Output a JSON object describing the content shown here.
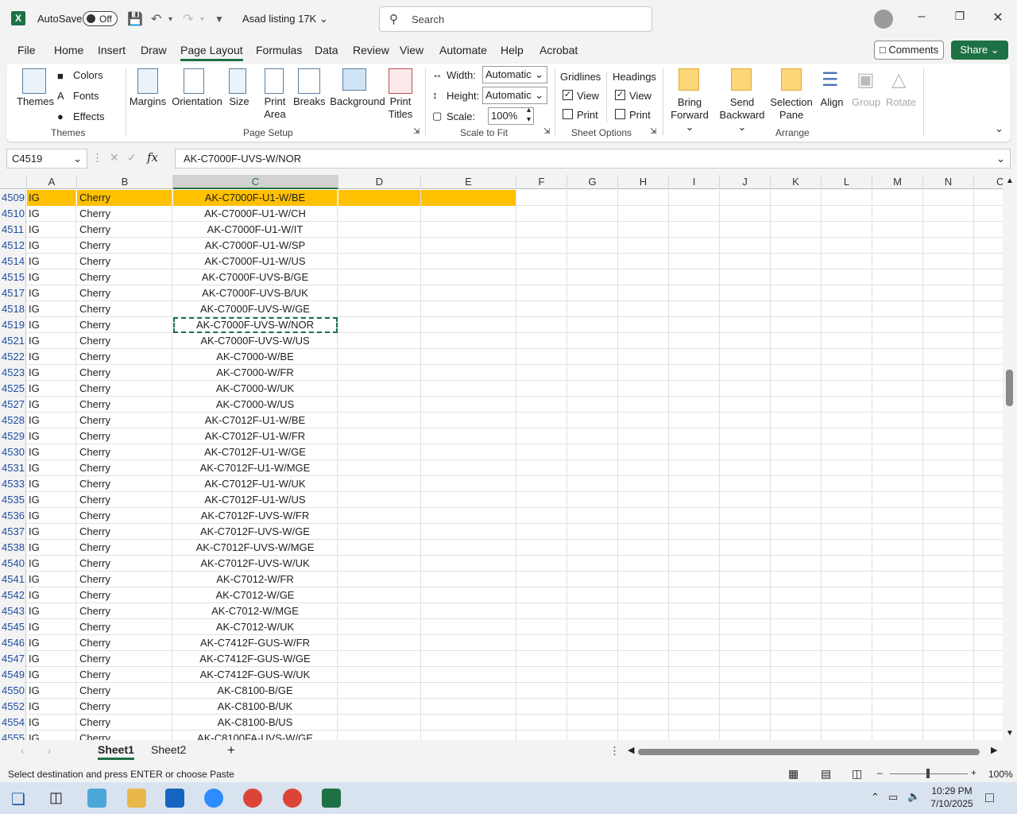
{
  "titlebar": {
    "autosave_label": "AutoSave",
    "autosave_state": "Off",
    "doc_title": "Asad listing 17K",
    "search_placeholder": "Search"
  },
  "menu": {
    "tabs": [
      "File",
      "Home",
      "Insert",
      "Draw",
      "Page Layout",
      "Formulas",
      "Data",
      "Review",
      "View",
      "Automate",
      "Help",
      "Acrobat"
    ],
    "active": "Page Layout",
    "comments": "Comments",
    "share": "Share"
  },
  "ribbon": {
    "themes": {
      "themes": "Themes",
      "colors": "Colors",
      "fonts": "Fonts",
      "effects": "Effects",
      "group": "Themes"
    },
    "page_setup": {
      "margins": "Margins",
      "orientation": "Orientation",
      "size": "Size",
      "print_area_1": "Print",
      "print_area_2": "Area",
      "breaks": "Breaks",
      "background": "Background",
      "print_titles_1": "Print",
      "print_titles_2": "Titles",
      "group": "Page Setup"
    },
    "scale_to_fit": {
      "width_label": "Width:",
      "width_value": "Automatic",
      "height_label": "Height:",
      "height_value": "Automatic",
      "scale_label": "Scale:",
      "scale_value": "100%",
      "group": "Scale to Fit"
    },
    "sheet_options": {
      "gridlines": "Gridlines",
      "headings": "Headings",
      "view": "View",
      "print": "Print",
      "group": "Sheet Options"
    },
    "arrange": {
      "bring_1": "Bring",
      "bring_2": "Forward",
      "send_1": "Send",
      "send_2": "Backward",
      "selection_1": "Selection",
      "selection_2": "Pane",
      "align": "Align",
      "group_btn": "Group",
      "rotate": "Rotate",
      "group": "Arrange"
    }
  },
  "formula_bar": {
    "name_box": "C4519",
    "fx": "fx",
    "content": "AK-C7000F-UVS-W/NOR"
  },
  "columns": [
    "A",
    "B",
    "C",
    "D",
    "E",
    "F",
    "G",
    "H",
    "I",
    "J",
    "K",
    "L",
    "M",
    "N",
    "C"
  ],
  "rows": [
    {
      "n": "4509",
      "a": "IG",
      "b": "Cherry",
      "c": "AK-C7000F-U1-W/BE"
    },
    {
      "n": "4510",
      "a": "IG",
      "b": "Cherry",
      "c": "AK-C7000F-U1-W/CH"
    },
    {
      "n": "4511",
      "a": "IG",
      "b": "Cherry",
      "c": "AK-C7000F-U1-W/IT"
    },
    {
      "n": "4512",
      "a": "IG",
      "b": "Cherry",
      "c": "AK-C7000F-U1-W/SP"
    },
    {
      "n": "4514",
      "a": "IG",
      "b": "Cherry",
      "c": "AK-C7000F-U1-W/US"
    },
    {
      "n": "4515",
      "a": "IG",
      "b": "Cherry",
      "c": "AK-C7000F-UVS-B/GE"
    },
    {
      "n": "4517",
      "a": "IG",
      "b": "Cherry",
      "c": "AK-C7000F-UVS-B/UK"
    },
    {
      "n": "4518",
      "a": "IG",
      "b": "Cherry",
      "c": "AK-C7000F-UVS-W/GE"
    },
    {
      "n": "4519",
      "a": "IG",
      "b": "Cherry",
      "c": "AK-C7000F-UVS-W/NOR"
    },
    {
      "n": "4521",
      "a": "IG",
      "b": "Cherry",
      "c": "AK-C7000F-UVS-W/US"
    },
    {
      "n": "4522",
      "a": "IG",
      "b": "Cherry",
      "c": "AK-C7000-W/BE"
    },
    {
      "n": "4523",
      "a": "IG",
      "b": "Cherry",
      "c": "AK-C7000-W/FR"
    },
    {
      "n": "4525",
      "a": "IG",
      "b": "Cherry",
      "c": "AK-C7000-W/UK"
    },
    {
      "n": "4527",
      "a": "IG",
      "b": "Cherry",
      "c": "AK-C7000-W/US"
    },
    {
      "n": "4528",
      "a": "IG",
      "b": "Cherry",
      "c": "AK-C7012F-U1-W/BE"
    },
    {
      "n": "4529",
      "a": "IG",
      "b": "Cherry",
      "c": "AK-C7012F-U1-W/FR"
    },
    {
      "n": "4530",
      "a": "IG",
      "b": "Cherry",
      "c": "AK-C7012F-U1-W/GE"
    },
    {
      "n": "4531",
      "a": "IG",
      "b": "Cherry",
      "c": "AK-C7012F-U1-W/MGE"
    },
    {
      "n": "4533",
      "a": "IG",
      "b": "Cherry",
      "c": "AK-C7012F-U1-W/UK"
    },
    {
      "n": "4535",
      "a": "IG",
      "b": "Cherry",
      "c": "AK-C7012F-U1-W/US"
    },
    {
      "n": "4536",
      "a": "IG",
      "b": "Cherry",
      "c": "AK-C7012F-UVS-W/FR"
    },
    {
      "n": "4537",
      "a": "IG",
      "b": "Cherry",
      "c": "AK-C7012F-UVS-W/GE"
    },
    {
      "n": "4538",
      "a": "IG",
      "b": "Cherry",
      "c": "AK-C7012F-UVS-W/MGE"
    },
    {
      "n": "4540",
      "a": "IG",
      "b": "Cherry",
      "c": "AK-C7012F-UVS-W/UK"
    },
    {
      "n": "4541",
      "a": "IG",
      "b": "Cherry",
      "c": "AK-C7012-W/FR"
    },
    {
      "n": "4542",
      "a": "IG",
      "b": "Cherry",
      "c": "AK-C7012-W/GE"
    },
    {
      "n": "4543",
      "a": "IG",
      "b": "Cherry",
      "c": "AK-C7012-W/MGE"
    },
    {
      "n": "4545",
      "a": "IG",
      "b": "Cherry",
      "c": "AK-C7012-W/UK"
    },
    {
      "n": "4546",
      "a": "IG",
      "b": "Cherry",
      "c": "AK-C7412F-GUS-W/FR"
    },
    {
      "n": "4547",
      "a": "IG",
      "b": "Cherry",
      "c": "AK-C7412F-GUS-W/GE"
    },
    {
      "n": "4549",
      "a": "IG",
      "b": "Cherry",
      "c": "AK-C7412F-GUS-W/UK"
    },
    {
      "n": "4550",
      "a": "IG",
      "b": "Cherry",
      "c": "AK-C8100-B/GE"
    },
    {
      "n": "4552",
      "a": "IG",
      "b": "Cherry",
      "c": "AK-C8100-B/UK"
    },
    {
      "n": "4554",
      "a": "IG",
      "b": "Cherry",
      "c": "AK-C8100-B/US"
    },
    {
      "n": "4555",
      "a": "IG",
      "b": "Cherry",
      "c": "AK-C8100FA-UVS-W/GE"
    }
  ],
  "highlight_row": "4509",
  "selected_row": "4519",
  "highlight_color": "#ffc000",
  "sheets": [
    "Sheet1",
    "Sheet2"
  ],
  "active_sheet": "Sheet1",
  "status": {
    "message": "Select destination and press ENTER or choose Paste",
    "zoom": "100%"
  },
  "taskbar": {
    "time": "10:29 PM",
    "date": "7/10/2025"
  },
  "colors": {
    "accent": "#1e7145",
    "row_numbers": "#1f4fa0"
  }
}
